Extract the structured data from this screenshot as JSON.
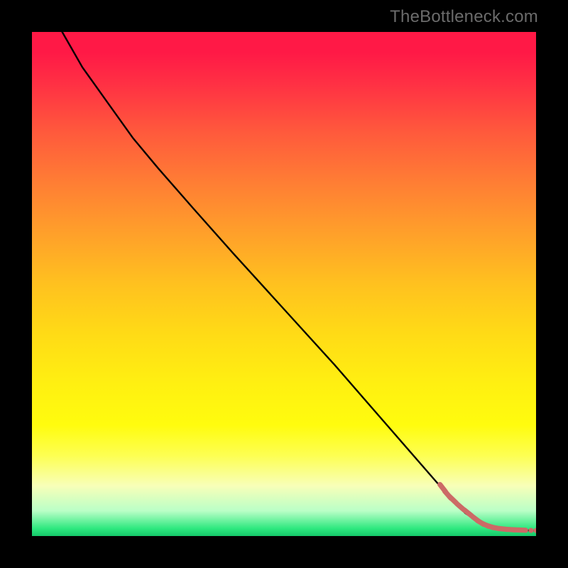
{
  "watermark": "TheBottleneck.com",
  "colors": {
    "line": "#000000",
    "marker": "#cc6a66",
    "background": "#000000"
  },
  "chart_data": {
    "type": "line",
    "title": "",
    "xlabel": "",
    "ylabel": "",
    "xlim": [
      0,
      100
    ],
    "ylim": [
      0,
      100
    ],
    "grid": false,
    "legend": false,
    "series": [
      {
        "name": "curve",
        "x": [
          6,
          10,
          15,
          20,
          25,
          32,
          40,
          50,
          60,
          70,
          80,
          84,
          86,
          88,
          89,
          90,
          91,
          92,
          93.5,
          95,
          97,
          99,
          100
        ],
        "y": [
          100,
          93,
          86,
          79,
          73,
          65,
          56,
          45,
          34,
          22.5,
          11,
          6.5,
          4.5,
          3.2,
          2.5,
          2.1,
          1.8,
          1.55,
          1.35,
          1.25,
          1.15,
          1.1,
          1.1
        ]
      }
    ],
    "markers": {
      "name": "highlight",
      "x": [
        81.5,
        82.5,
        83.5,
        85,
        86.5,
        88,
        89,
        90,
        91,
        92,
        93.5,
        95,
        96.2,
        97.2,
        99,
        100
      ],
      "y": [
        9.5,
        8.2,
        7.2,
        5.8,
        4.6,
        3.4,
        2.7,
        2.2,
        1.85,
        1.6,
        1.4,
        1.28,
        1.22,
        1.18,
        1.12,
        1.1
      ]
    }
  }
}
